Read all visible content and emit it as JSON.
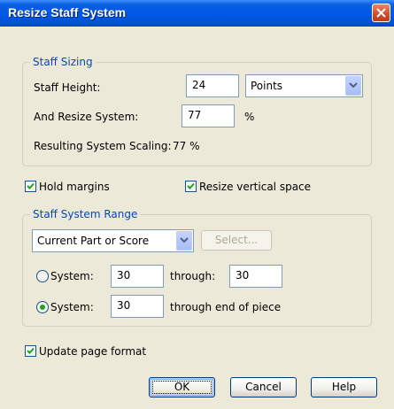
{
  "window": {
    "title": "Resize Staff System"
  },
  "staff_sizing": {
    "legend": "Staff Sizing",
    "height_label": "Staff Height:",
    "height_value": "24",
    "units_value": "Points",
    "resize_label": "And Resize System:",
    "resize_value": "77",
    "percent_sign": "%",
    "resulting_label": "Resulting System Scaling:",
    "resulting_value": "77 %"
  },
  "options": {
    "hold_margins_label": "Hold margins",
    "hold_margins_checked": true,
    "resize_vertical_label": "Resize vertical space",
    "resize_vertical_checked": true
  },
  "range": {
    "legend": "Staff System Range",
    "scope_value": "Current Part or Score",
    "select_label": "Select...",
    "system_label": "System:",
    "from_value": "30",
    "through_label": "through:",
    "through_value": "30",
    "system2_label": "System:",
    "start_value": "30",
    "end_label": "through end of piece",
    "selected_option": 2
  },
  "update_page_format": {
    "label": "Update page format",
    "checked": true
  },
  "buttons": {
    "ok": "OK",
    "cancel": "Cancel",
    "help": "Help"
  },
  "colors": {
    "title_bar": "#0058E6",
    "legend_text": "#0046D5",
    "dialog_bg": "#ECE9D8",
    "checkmark": "#21A121"
  }
}
